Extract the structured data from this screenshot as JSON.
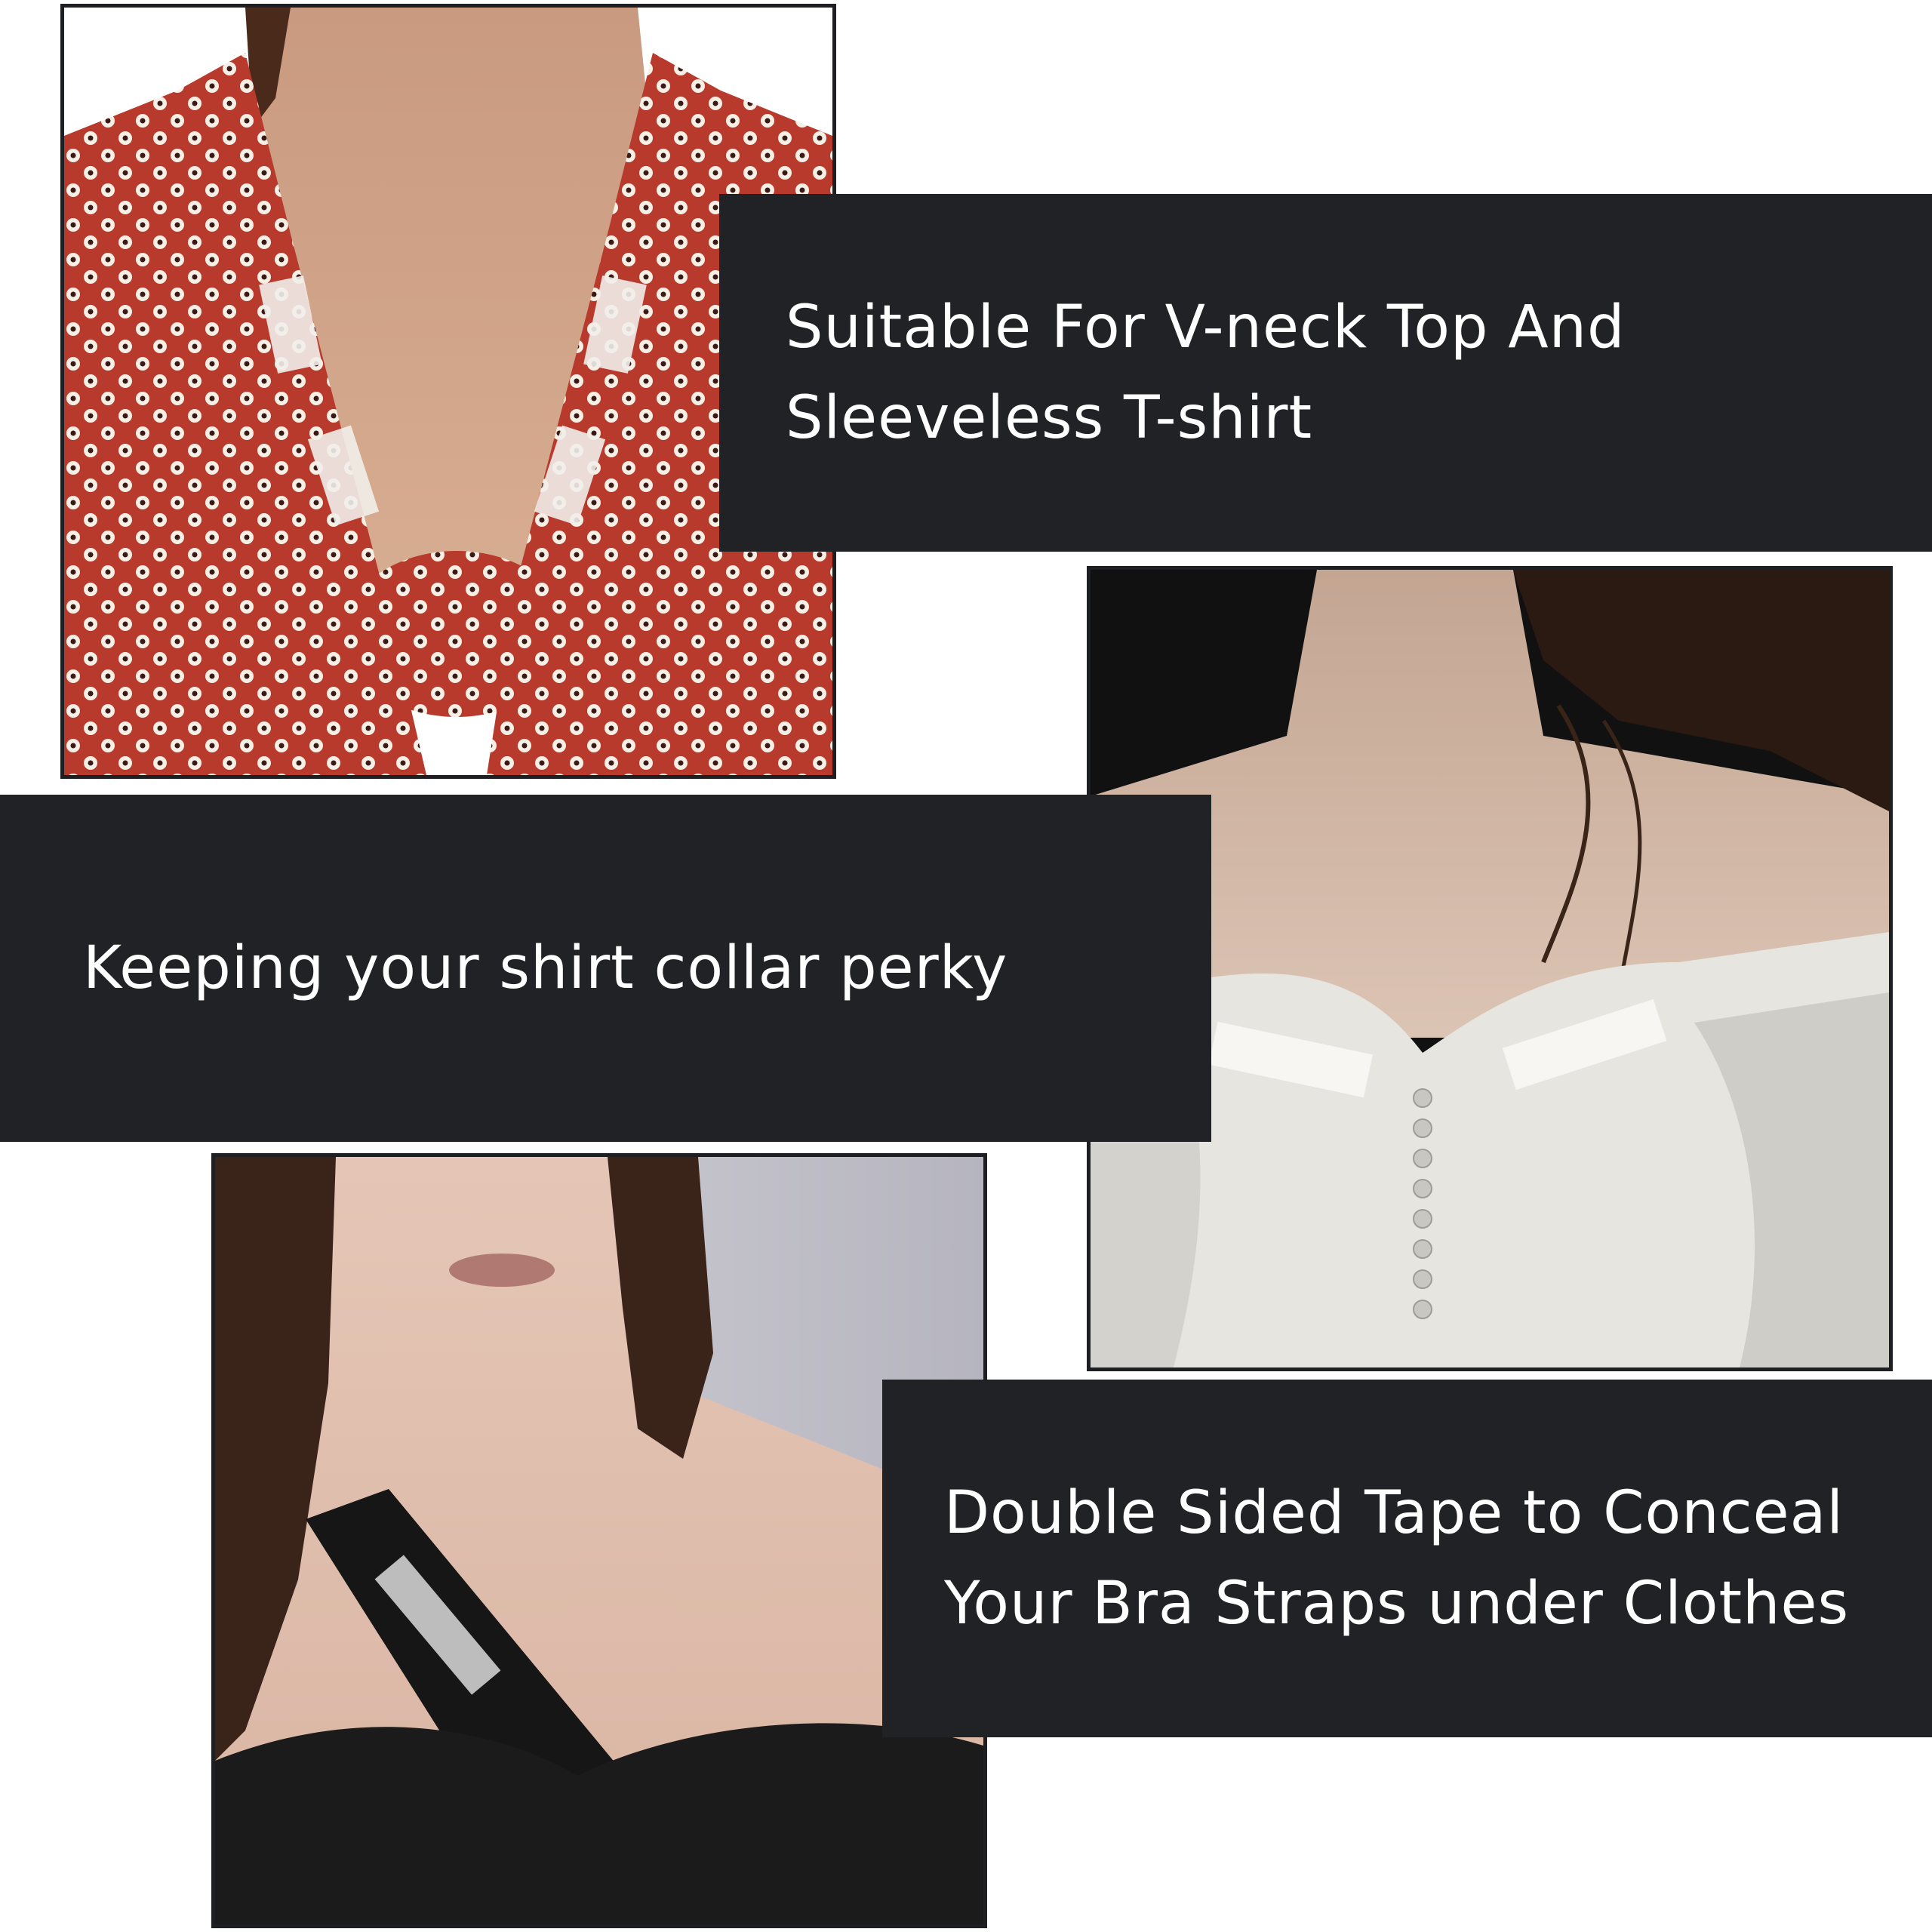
{
  "panels": {
    "vneck": {
      "text": "Suitable For V-neck Top And\nSleeveless T-shirt"
    },
    "collar": {
      "text": "Keeping your shirt collar perky"
    },
    "bra_straps": {
      "text": "Double Sided Tape to Conceal\nYour Bra Straps under Clothes"
    }
  },
  "colors": {
    "panel_background": "#212226",
    "panel_text": "#ffffff",
    "page_background": "#ffffff",
    "red_print": "#b83a2c"
  }
}
